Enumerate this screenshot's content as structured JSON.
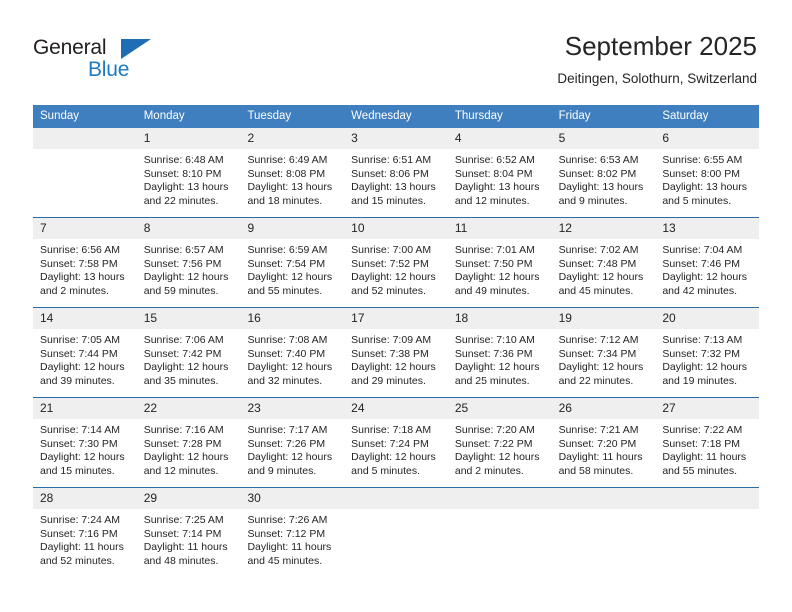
{
  "brand": {
    "name_top": "General",
    "name_bottom": "Blue",
    "triangle_icon": "blue-triangle-logo-mark",
    "color_dark": "#231f20",
    "color_blue": "#1f7ac4"
  },
  "header": {
    "title": "September 2025",
    "subtitle": "Deitingen, Solothurn, Switzerland"
  },
  "theme": {
    "header_row_bg": "#3f7fbf",
    "header_row_text": "#ffffff",
    "date_band_bg": "#efefef",
    "week_divider": "#2b6ca8",
    "body_text": "#242424"
  },
  "weekday_headers": [
    "Sunday",
    "Monday",
    "Tuesday",
    "Wednesday",
    "Thursday",
    "Friday",
    "Saturday"
  ],
  "weeks": [
    {
      "days": [
        {
          "date": "",
          "lines": []
        },
        {
          "date": "1",
          "lines": [
            "Sunrise: 6:48 AM",
            "Sunset: 8:10 PM",
            "Daylight: 13 hours",
            "and 22 minutes."
          ]
        },
        {
          "date": "2",
          "lines": [
            "Sunrise: 6:49 AM",
            "Sunset: 8:08 PM",
            "Daylight: 13 hours",
            "and 18 minutes."
          ]
        },
        {
          "date": "3",
          "lines": [
            "Sunrise: 6:51 AM",
            "Sunset: 8:06 PM",
            "Daylight: 13 hours",
            "and 15 minutes."
          ]
        },
        {
          "date": "4",
          "lines": [
            "Sunrise: 6:52 AM",
            "Sunset: 8:04 PM",
            "Daylight: 13 hours",
            "and 12 minutes."
          ]
        },
        {
          "date": "5",
          "lines": [
            "Sunrise: 6:53 AM",
            "Sunset: 8:02 PM",
            "Daylight: 13 hours",
            "and 9 minutes."
          ]
        },
        {
          "date": "6",
          "lines": [
            "Sunrise: 6:55 AM",
            "Sunset: 8:00 PM",
            "Daylight: 13 hours",
            "and 5 minutes."
          ]
        }
      ]
    },
    {
      "days": [
        {
          "date": "7",
          "lines": [
            "Sunrise: 6:56 AM",
            "Sunset: 7:58 PM",
            "Daylight: 13 hours",
            "and 2 minutes."
          ]
        },
        {
          "date": "8",
          "lines": [
            "Sunrise: 6:57 AM",
            "Sunset: 7:56 PM",
            "Daylight: 12 hours",
            "and 59 minutes."
          ]
        },
        {
          "date": "9",
          "lines": [
            "Sunrise: 6:59 AM",
            "Sunset: 7:54 PM",
            "Daylight: 12 hours",
            "and 55 minutes."
          ]
        },
        {
          "date": "10",
          "lines": [
            "Sunrise: 7:00 AM",
            "Sunset: 7:52 PM",
            "Daylight: 12 hours",
            "and 52 minutes."
          ]
        },
        {
          "date": "11",
          "lines": [
            "Sunrise: 7:01 AM",
            "Sunset: 7:50 PM",
            "Daylight: 12 hours",
            "and 49 minutes."
          ]
        },
        {
          "date": "12",
          "lines": [
            "Sunrise: 7:02 AM",
            "Sunset: 7:48 PM",
            "Daylight: 12 hours",
            "and 45 minutes."
          ]
        },
        {
          "date": "13",
          "lines": [
            "Sunrise: 7:04 AM",
            "Sunset: 7:46 PM",
            "Daylight: 12 hours",
            "and 42 minutes."
          ]
        }
      ]
    },
    {
      "days": [
        {
          "date": "14",
          "lines": [
            "Sunrise: 7:05 AM",
            "Sunset: 7:44 PM",
            "Daylight: 12 hours",
            "and 39 minutes."
          ]
        },
        {
          "date": "15",
          "lines": [
            "Sunrise: 7:06 AM",
            "Sunset: 7:42 PM",
            "Daylight: 12 hours",
            "and 35 minutes."
          ]
        },
        {
          "date": "16",
          "lines": [
            "Sunrise: 7:08 AM",
            "Sunset: 7:40 PM",
            "Daylight: 12 hours",
            "and 32 minutes."
          ]
        },
        {
          "date": "17",
          "lines": [
            "Sunrise: 7:09 AM",
            "Sunset: 7:38 PM",
            "Daylight: 12 hours",
            "and 29 minutes."
          ]
        },
        {
          "date": "18",
          "lines": [
            "Sunrise: 7:10 AM",
            "Sunset: 7:36 PM",
            "Daylight: 12 hours",
            "and 25 minutes."
          ]
        },
        {
          "date": "19",
          "lines": [
            "Sunrise: 7:12 AM",
            "Sunset: 7:34 PM",
            "Daylight: 12 hours",
            "and 22 minutes."
          ]
        },
        {
          "date": "20",
          "lines": [
            "Sunrise: 7:13 AM",
            "Sunset: 7:32 PM",
            "Daylight: 12 hours",
            "and 19 minutes."
          ]
        }
      ]
    },
    {
      "days": [
        {
          "date": "21",
          "lines": [
            "Sunrise: 7:14 AM",
            "Sunset: 7:30 PM",
            "Daylight: 12 hours",
            "and 15 minutes."
          ]
        },
        {
          "date": "22",
          "lines": [
            "Sunrise: 7:16 AM",
            "Sunset: 7:28 PM",
            "Daylight: 12 hours",
            "and 12 minutes."
          ]
        },
        {
          "date": "23",
          "lines": [
            "Sunrise: 7:17 AM",
            "Sunset: 7:26 PM",
            "Daylight: 12 hours",
            "and 9 minutes."
          ]
        },
        {
          "date": "24",
          "lines": [
            "Sunrise: 7:18 AM",
            "Sunset: 7:24 PM",
            "Daylight: 12 hours",
            "and 5 minutes."
          ]
        },
        {
          "date": "25",
          "lines": [
            "Sunrise: 7:20 AM",
            "Sunset: 7:22 PM",
            "Daylight: 12 hours",
            "and 2 minutes."
          ]
        },
        {
          "date": "26",
          "lines": [
            "Sunrise: 7:21 AM",
            "Sunset: 7:20 PM",
            "Daylight: 11 hours",
            "and 58 minutes."
          ]
        },
        {
          "date": "27",
          "lines": [
            "Sunrise: 7:22 AM",
            "Sunset: 7:18 PM",
            "Daylight: 11 hours",
            "and 55 minutes."
          ]
        }
      ]
    },
    {
      "days": [
        {
          "date": "28",
          "lines": [
            "Sunrise: 7:24 AM",
            "Sunset: 7:16 PM",
            "Daylight: 11 hours",
            "and 52 minutes."
          ]
        },
        {
          "date": "29",
          "lines": [
            "Sunrise: 7:25 AM",
            "Sunset: 7:14 PM",
            "Daylight: 11 hours",
            "and 48 minutes."
          ]
        },
        {
          "date": "30",
          "lines": [
            "Sunrise: 7:26 AM",
            "Sunset: 7:12 PM",
            "Daylight: 11 hours",
            "and 45 minutes."
          ]
        },
        {
          "date": "",
          "lines": []
        },
        {
          "date": "",
          "lines": []
        },
        {
          "date": "",
          "lines": []
        },
        {
          "date": "",
          "lines": []
        }
      ]
    }
  ]
}
